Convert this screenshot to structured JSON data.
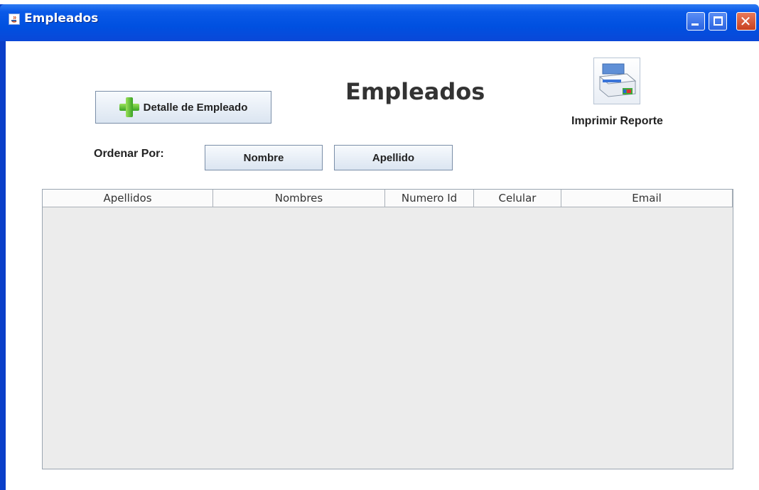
{
  "window": {
    "title": "Empleados"
  },
  "main": {
    "heading": "Empleados",
    "detail_button_label": "Detalle de Empleado",
    "print_label": "Imprimir Reporte",
    "order_by_label": "Ordenar Por:",
    "sort_buttons": [
      "Nombre",
      "Apellido"
    ]
  },
  "table": {
    "columns": [
      "Apellidos",
      "Nombres",
      "Numero Id",
      "Celular",
      "Email"
    ],
    "rows": []
  },
  "colors": {
    "titlebar": "#0050e0",
    "accent_green": "#3aa324",
    "button_border": "#7a8ea8"
  },
  "icons": {
    "app": "java-app-icon",
    "add": "plus-icon",
    "print": "printer-icon"
  }
}
